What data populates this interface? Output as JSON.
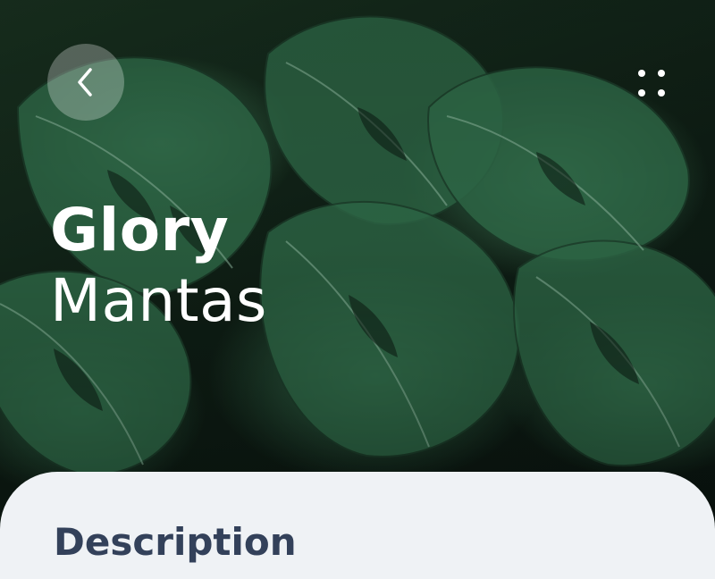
{
  "header": {
    "back_icon": "chevron-left-icon",
    "menu_icon": "four-dots-grid-icon",
    "title_line1": "Glory",
    "title_line2": "Mantas"
  },
  "hero": {
    "image": "monstera-leaves-photo"
  },
  "sheet": {
    "heading": "Description"
  },
  "colors": {
    "sheet_background": "#eff2f5",
    "heading_text": "#33415a",
    "title_text": "#ffffff",
    "back_button_bg": "rgba(255,255,255,0.28)"
  }
}
